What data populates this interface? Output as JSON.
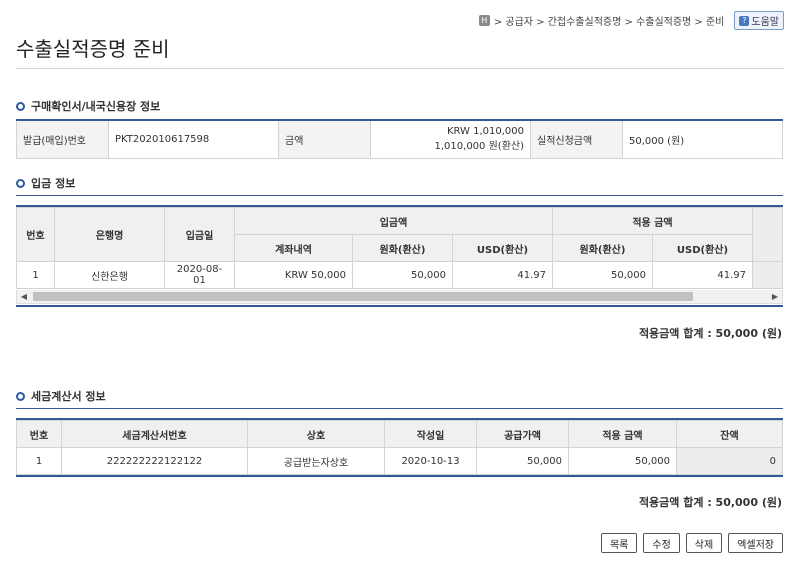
{
  "breadcrumb": {
    "home_glyph": "H",
    "path": "> 공급자 > 간접수출실적증명 > 수출실적증명 > 준비",
    "help_label": "도움말"
  },
  "page_title": "수출실적증명 준비",
  "purchase_section": {
    "title": "구매확인서/내국신용장 정보",
    "issue_no_label": "발급(매입)번호",
    "issue_no": "PKT202010617598",
    "amount_label": "금액",
    "amount_line1": "KRW 1,010,000",
    "amount_line2": "1,010,000 원(환산)",
    "claim_label": "실적신청금액",
    "claim_value": "50,000 (원)"
  },
  "deposit_section": {
    "title": "입금 정보",
    "headers": {
      "no": "번호",
      "bank": "은행명",
      "date": "입금일",
      "deposit_group": "입금액",
      "applied_group": "적용 금액",
      "account": "계좌내역",
      "krw": "원화(환산)",
      "usd": "USD(환산)",
      "applied_krw": "원화(환산)",
      "applied_usd": "USD(환산)"
    },
    "rows": [
      {
        "no": "1",
        "bank": "신한은행",
        "date": "2020-08-01",
        "account": "KRW 50,000",
        "krw": "50,000",
        "usd": "41.97",
        "applied_krw": "50,000",
        "applied_usd": "41.97"
      }
    ],
    "total": "적용금액 합계 : 50,000 (원)"
  },
  "tax_section": {
    "title": "세금계산서 정보",
    "headers": {
      "no": "번호",
      "invoice_no": "세금계산서번호",
      "company": "상호",
      "date": "작성일",
      "supply": "공급가액",
      "applied": "적용 금액",
      "balance": "잔액"
    },
    "rows": [
      {
        "no": "1",
        "invoice_no": "222222222122122",
        "company": "공급받는자상호",
        "date": "2020-10-13",
        "supply": "50,000",
        "applied": "50,000",
        "balance": "0"
      }
    ],
    "total": "적용금액 합계 : 50,000 (원)"
  },
  "buttons": {
    "list": "목록",
    "edit": "수정",
    "delete": "삭제",
    "excel": "엑셀저장"
  },
  "colors": {
    "accent": "#345a94",
    "header_bg": "#f0f0f0"
  }
}
